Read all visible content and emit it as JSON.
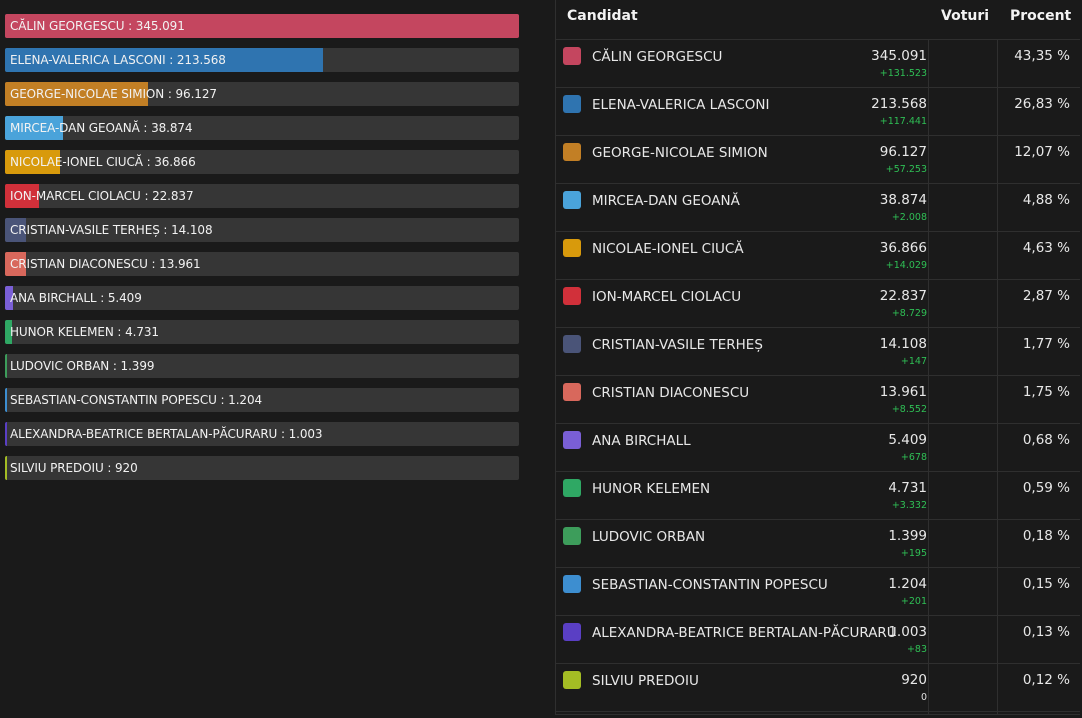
{
  "table": {
    "headers": {
      "candidate": "Candidat",
      "votes": "Voturi",
      "percent": "Procent"
    }
  },
  "candidates": [
    {
      "name": "CĂLIN GEORGESCU",
      "bar_label": "CĂLIN GEORGESCU : 345.091",
      "votes": "345.091",
      "delta": "+131.523",
      "percent": "43,35 %",
      "votes_value": 345091,
      "color": "#c4465f"
    },
    {
      "name": "ELENA-VALERICA LASCONI",
      "bar_label": "ELENA-VALERICA LASCONI : 213.568",
      "votes": "213.568",
      "delta": "+117.441",
      "percent": "26,83 %",
      "votes_value": 213568,
      "color": "#2f74b0"
    },
    {
      "name": "GEORGE-NICOLAE SIMION",
      "bar_label": "GEORGE-NICOLAE SIMION : 96.127",
      "votes": "96.127",
      "delta": "+57.253",
      "percent": "12,07 %",
      "votes_value": 96127,
      "color": "#c27f25"
    },
    {
      "name": "MIRCEA-DAN GEOANĂ",
      "bar_label": "MIRCEA-DAN GEOANĂ : 38.874",
      "votes": "38.874",
      "delta": "+2.008",
      "percent": "4,88 %",
      "votes_value": 38874,
      "color": "#4aa3da"
    },
    {
      "name": "NICOLAE-IONEL CIUCĂ",
      "bar_label": "NICOLAE-IONEL CIUCĂ : 36.866",
      "votes": "36.866",
      "delta": "+14.029",
      "percent": "4,63 %",
      "votes_value": 36866,
      "color": "#d89a0c"
    },
    {
      "name": "ION-MARCEL CIOLACU",
      "bar_label": "ION-MARCEL CIOLACU : 22.837",
      "votes": "22.837",
      "delta": "+8.729",
      "percent": "2,87 %",
      "votes_value": 22837,
      "color": "#d1303a"
    },
    {
      "name": "CRISTIAN-VASILE TERHEȘ",
      "bar_label": "CRISTIAN-VASILE TERHEȘ : 14.108",
      "votes": "14.108",
      "delta": "+147",
      "percent": "1,77 %",
      "votes_value": 14108,
      "color": "#4a5478"
    },
    {
      "name": "CRISTIAN DIACONESCU",
      "bar_label": "CRISTIAN DIACONESCU : 13.961",
      "votes": "13.961",
      "delta": "+8.552",
      "percent": "1,75 %",
      "votes_value": 13961,
      "color": "#d8685c"
    },
    {
      "name": "ANA BIRCHALL",
      "bar_label": "ANA BIRCHALL : 5.409",
      "votes": "5.409",
      "delta": "+678",
      "percent": "0,68 %",
      "votes_value": 5409,
      "color": "#7a5fd6"
    },
    {
      "name": "HUNOR KELEMEN",
      "bar_label": "HUNOR KELEMEN : 4.731",
      "votes": "4.731",
      "delta": "+3.332",
      "percent": "0,59 %",
      "votes_value": 4731,
      "color": "#2fa864"
    },
    {
      "name": "LUDOVIC ORBAN",
      "bar_label": "LUDOVIC ORBAN : 1.399",
      "votes": "1.399",
      "delta": "+195",
      "percent": "0,18 %",
      "votes_value": 1399,
      "color": "#3d9d5b"
    },
    {
      "name": "SEBASTIAN-CONSTANTIN POPESCU",
      "bar_label": "SEBASTIAN-CONSTANTIN POPESCU : 1.204",
      "votes": "1.204",
      "delta": "+201",
      "percent": "0,15 %",
      "votes_value": 1204,
      "color": "#3d8ed0"
    },
    {
      "name": "ALEXANDRA-BEATRICE BERTALAN-PĂCURARU",
      "bar_label": "ALEXANDRA-BEATRICE BERTALAN-PĂCURARU : 1.003",
      "votes": "1.003",
      "delta": "+83",
      "percent": "0,13 %",
      "votes_value": 1003,
      "color": "#5a3fc4"
    },
    {
      "name": "SILVIU PREDOIU",
      "bar_label": "SILVIU PREDOIU : 920",
      "votes": "920",
      "delta": "0",
      "percent": "0,12 %",
      "votes_value": 920,
      "color": "#a4bd24"
    }
  ]
}
